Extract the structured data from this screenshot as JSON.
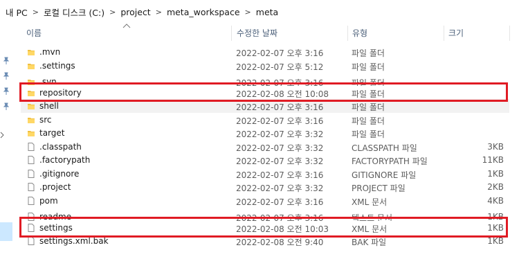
{
  "breadcrumb": [
    "내 PC",
    "로컬 디스크 (C:)",
    "project",
    "meta_workspace",
    "meta"
  ],
  "breadcrumb_separator": ">",
  "columns": {
    "name": "이름",
    "modified": "수정한 날짜",
    "type": "유형",
    "size": "크기"
  },
  "files": [
    {
      "name": ".mvn",
      "modified": "2022-02-07 오후 3:16",
      "type": "파일 폴더",
      "size": "",
      "icon": "folder-icon"
    },
    {
      "name": ".settings",
      "modified": "2022-02-07 오후 5:12",
      "type": "파일 폴더",
      "size": "",
      "icon": "folder-icon"
    },
    {
      "name": ".svn",
      "modified": "2022-02-07 오후 3:16",
      "type": "파일 폴더",
      "size": "",
      "icon": "folder-icon"
    },
    {
      "name": "repository",
      "modified": "2022-02-08 오전 10:08",
      "type": "파일 폴더",
      "size": "",
      "icon": "folder-icon"
    },
    {
      "name": "shell",
      "modified": "2022-02-07 오후 3:16",
      "type": "파일 폴더",
      "size": "",
      "icon": "folder-icon"
    },
    {
      "name": "src",
      "modified": "2022-02-07 오후 3:16",
      "type": "파일 폴더",
      "size": "",
      "icon": "folder-icon"
    },
    {
      "name": "target",
      "modified": "2022-02-07 오후 3:32",
      "type": "파일 폴더",
      "size": "",
      "icon": "folder-icon"
    },
    {
      "name": ".classpath",
      "modified": "2022-02-07 오후 3:32",
      "type": "CLASSPATH 파일",
      "size": "3KB",
      "icon": "file-icon"
    },
    {
      "name": ".factorypath",
      "modified": "2022-02-07 오후 3:32",
      "type": "FACTORYPATH 파일",
      "size": "11KB",
      "icon": "file-icon"
    },
    {
      "name": ".gitignore",
      "modified": "2022-02-07 오후 3:16",
      "type": "GITIGNORE 파일",
      "size": "1KB",
      "icon": "file-icon"
    },
    {
      "name": ".project",
      "modified": "2022-02-07 오후 3:32",
      "type": "PROJECT 파일",
      "size": "2KB",
      "icon": "file-icon"
    },
    {
      "name": "pom",
      "modified": "2022-02-07 오후 3:16",
      "type": "XML 문서",
      "size": "4KB",
      "icon": "file-icon"
    },
    {
      "name": "readme",
      "modified": "2022-02-07 오후 3:16",
      "type": "텍스트 문서",
      "size": "1KB",
      "icon": "file-icon"
    },
    {
      "name": "settings",
      "modified": "2022-02-08 오전 10:03",
      "type": "XML 문서",
      "size": "1KB",
      "icon": "file-icon"
    },
    {
      "name": "settings.xml.bak",
      "modified": "2022-02-08 오전 9:40",
      "type": "BAK 파일",
      "size": "1KB",
      "icon": "file-icon"
    }
  ],
  "highlighted_row": "shell",
  "annotation_color": "#e01b24",
  "folder_color": "#f0c040",
  "selection_color": "#cce8ff"
}
